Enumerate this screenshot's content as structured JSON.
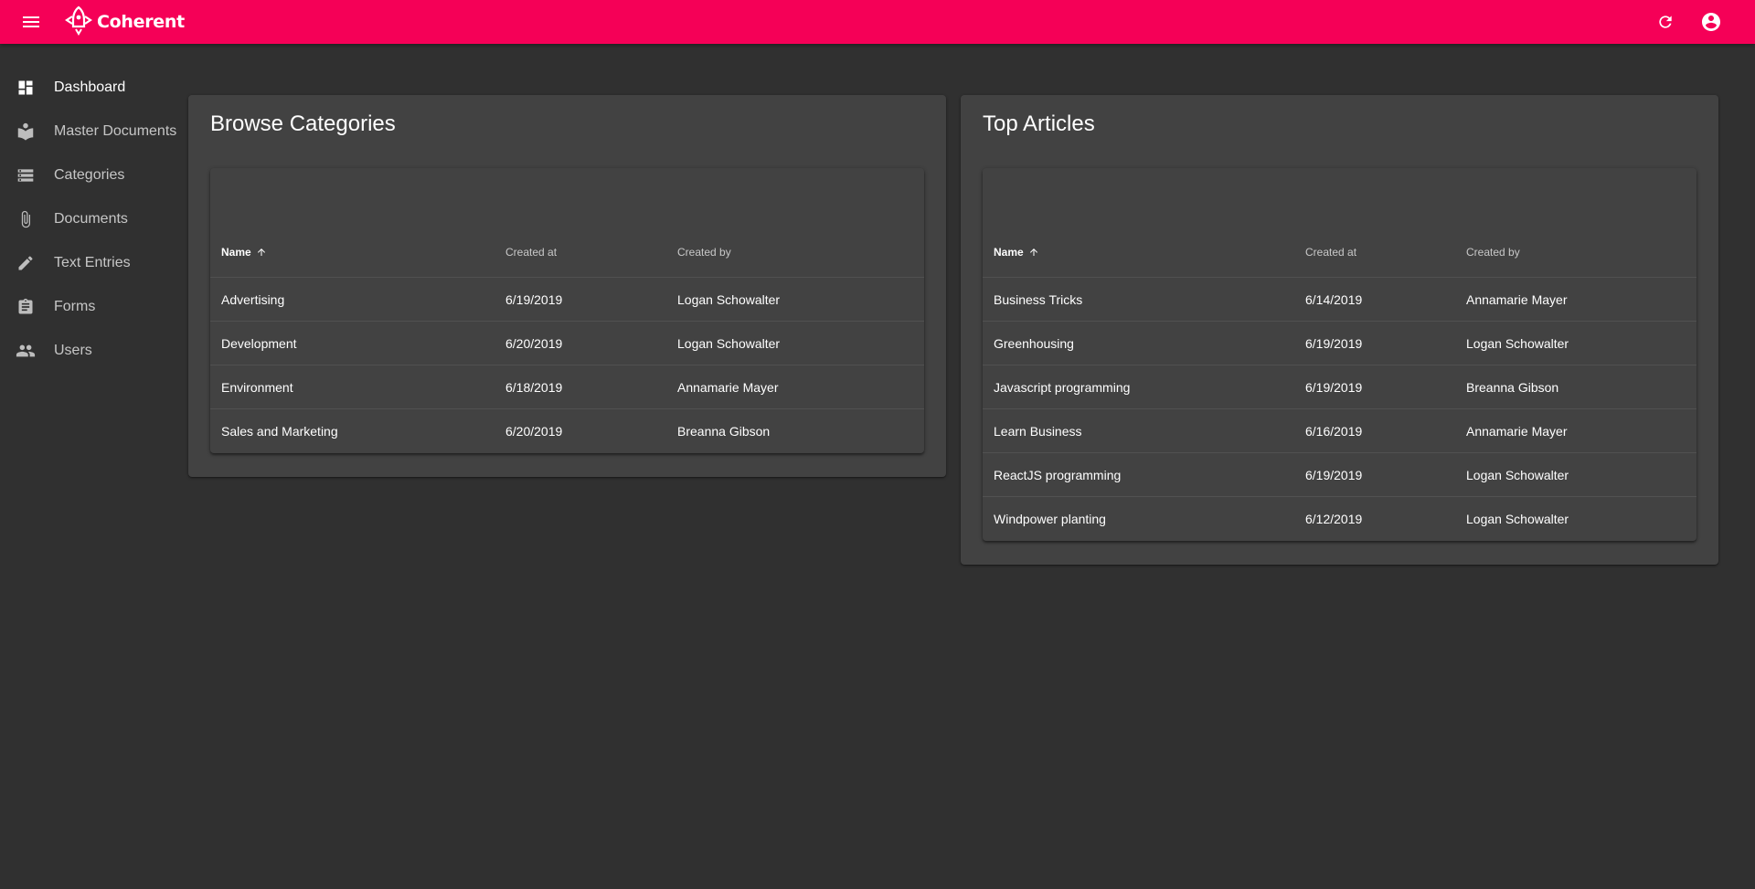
{
  "header": {
    "brand": "Coherent",
    "menu_icon": "menu-icon",
    "refresh_icon": "refresh-icon",
    "account_icon": "account-circle-icon",
    "color": "#f50057"
  },
  "sidebar": {
    "items": [
      {
        "label": "Dashboard",
        "icon": "dashboard-icon",
        "active": true
      },
      {
        "label": "Master Documents",
        "icon": "book-icon",
        "active": false
      },
      {
        "label": "Categories",
        "icon": "storage-icon",
        "active": false
      },
      {
        "label": "Documents",
        "icon": "attachment-icon",
        "active": false
      },
      {
        "label": "Text Entries",
        "icon": "pencil-icon",
        "active": false
      },
      {
        "label": "Forms",
        "icon": "clipboard-icon",
        "active": false
      },
      {
        "label": "Users",
        "icon": "people-icon",
        "active": false
      }
    ]
  },
  "categories_panel": {
    "title": "Browse Categories",
    "columns": [
      "Name",
      "Created at",
      "Created by"
    ],
    "sort_column": "Name",
    "rows": [
      {
        "name": "Advertising",
        "created_at": "6/19/2019",
        "created_by": "Logan Schowalter"
      },
      {
        "name": "Development",
        "created_at": "6/20/2019",
        "created_by": "Logan Schowalter"
      },
      {
        "name": "Environment",
        "created_at": "6/18/2019",
        "created_by": "Annamarie Mayer"
      },
      {
        "name": "Sales and Marketing",
        "created_at": "6/20/2019",
        "created_by": "Breanna Gibson"
      }
    ]
  },
  "articles_panel": {
    "title": "Top Articles",
    "columns": [
      "Name",
      "Created at",
      "Created by"
    ],
    "sort_column": "Name",
    "rows": [
      {
        "name": "Business Tricks",
        "created_at": "6/14/2019",
        "created_by": "Annamarie Mayer"
      },
      {
        "name": "Greenhousing",
        "created_at": "6/19/2019",
        "created_by": "Logan Schowalter"
      },
      {
        "name": "Javascript programming",
        "created_at": "6/19/2019",
        "created_by": "Breanna Gibson"
      },
      {
        "name": "Learn Business",
        "created_at": "6/16/2019",
        "created_by": "Annamarie Mayer"
      },
      {
        "name": "ReactJS programming",
        "created_at": "6/19/2019",
        "created_by": "Logan Schowalter"
      },
      {
        "name": "Windpower planting",
        "created_at": "6/12/2019",
        "created_by": "Logan Schowalter"
      }
    ]
  }
}
